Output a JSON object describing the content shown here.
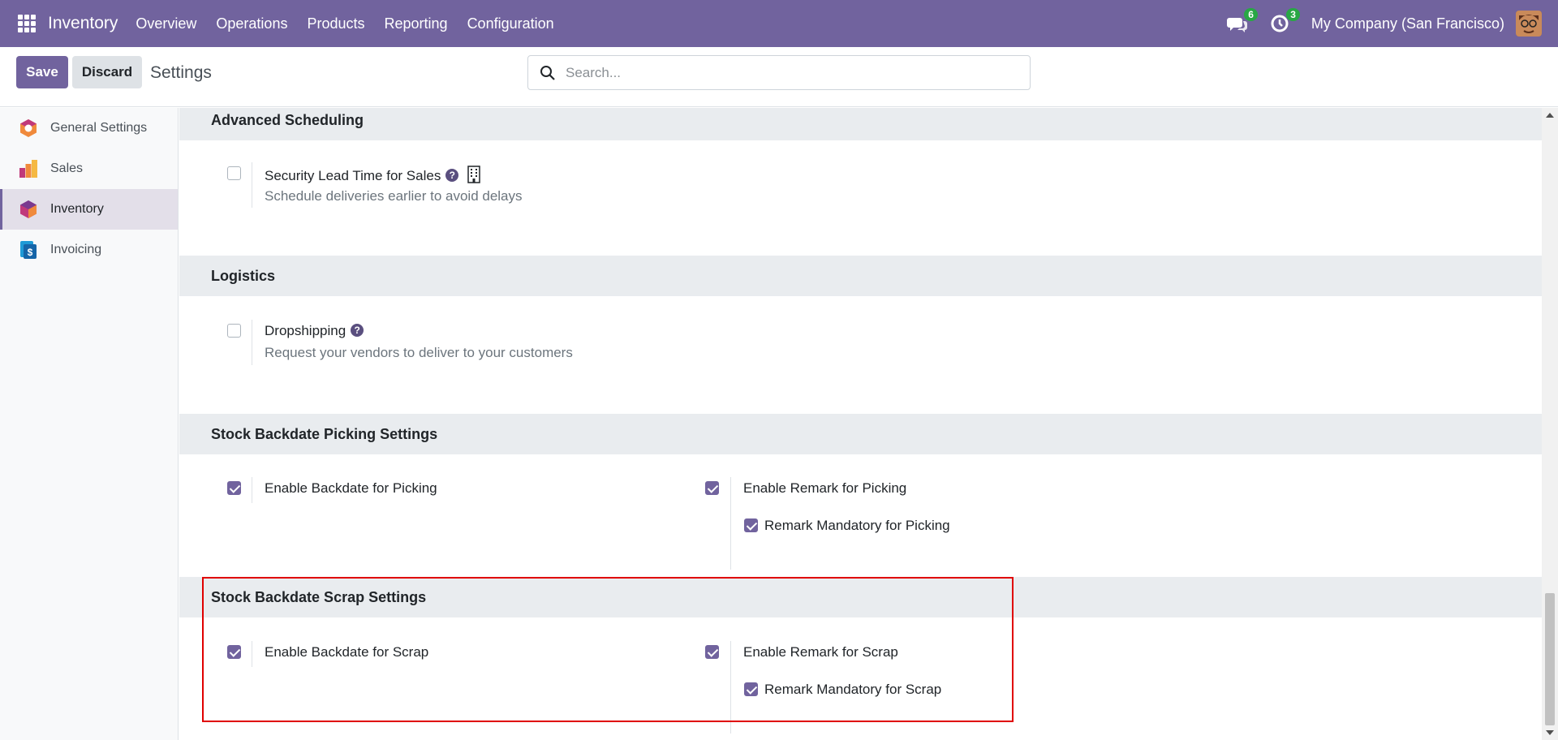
{
  "navbar": {
    "brand": "Inventory",
    "menu": [
      "Overview",
      "Operations",
      "Products",
      "Reporting",
      "Configuration"
    ],
    "messages_count": "6",
    "activities_count": "3",
    "company": "My Company (San Francisco)"
  },
  "control": {
    "save_label": "Save",
    "discard_label": "Discard",
    "breadcrumb": "Settings",
    "search_placeholder": "Search..."
  },
  "sidebar": {
    "items": [
      {
        "label": "General Settings",
        "icon": "general-settings-icon"
      },
      {
        "label": "Sales",
        "icon": "sales-icon"
      },
      {
        "label": "Inventory",
        "icon": "inventory-icon",
        "active": true
      },
      {
        "label": "Invoicing",
        "icon": "invoicing-icon"
      }
    ]
  },
  "sections": {
    "advanced_scheduling": {
      "title": "Advanced Scheduling",
      "security_lead_time": {
        "label": "Security Lead Time for Sales",
        "description": "Schedule deliveries earlier to avoid delays",
        "checked": false
      }
    },
    "logistics": {
      "title": "Logistics",
      "dropshipping": {
        "label": "Dropshipping",
        "description": "Request your vendors to deliver to your customers",
        "checked": false
      }
    },
    "picking": {
      "title": "Stock Backdate Picking Settings",
      "enable_backdate": {
        "label": "Enable Backdate for Picking",
        "checked": true
      },
      "enable_remark": {
        "label": "Enable Remark for Picking",
        "checked": true
      },
      "remark_mandatory": {
        "label": "Remark Mandatory for Picking",
        "checked": true
      }
    },
    "scrap": {
      "title": "Stock Backdate Scrap Settings",
      "enable_backdate": {
        "label": "Enable Backdate for Scrap",
        "checked": true
      },
      "enable_remark": {
        "label": "Enable Remark for Scrap",
        "checked": true
      },
      "remark_mandatory": {
        "label": "Remark Mandatory for Scrap",
        "checked": true
      }
    }
  },
  "colors": {
    "brand": "#71639e",
    "highlight": "#e00000"
  }
}
